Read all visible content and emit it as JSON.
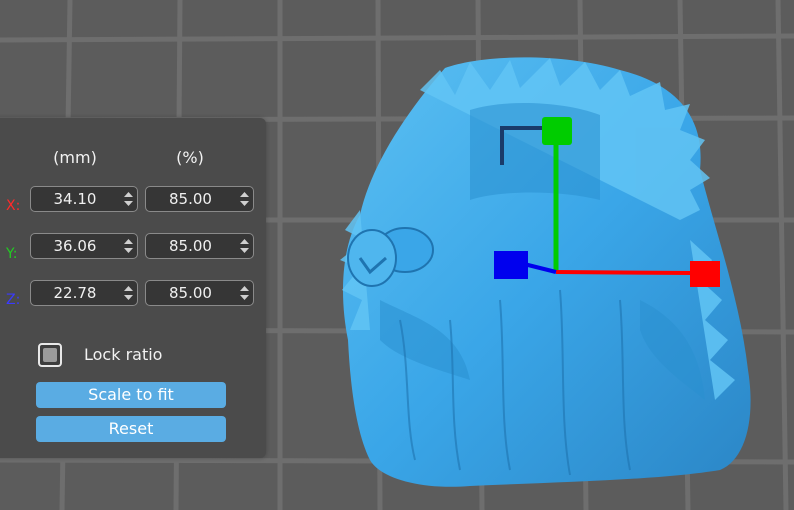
{
  "scale_panel": {
    "col_mm": "(mm)",
    "col_percent": "(%)",
    "axes": [
      {
        "label": "X:",
        "color": "#ff2a2a",
        "mm": "34.10",
        "percent": "85.00"
      },
      {
        "label": "Y:",
        "color": "#22cc22",
        "mm": "36.06",
        "percent": "85.00"
      },
      {
        "label": "Z:",
        "color": "#3a3aff",
        "mm": "22.78",
        "percent": "85.00"
      }
    ],
    "lock_ratio_label": "Lock ratio",
    "lock_ratio_checked": false,
    "scale_to_fit_label": "Scale to fit",
    "reset_label": "Reset"
  },
  "colors": {
    "accent": "#5aace3",
    "model": "#3aa6e8",
    "gizmo_x": "#ff0000",
    "gizmo_y": "#00cc00",
    "gizmo_z": "#0000ee"
  }
}
